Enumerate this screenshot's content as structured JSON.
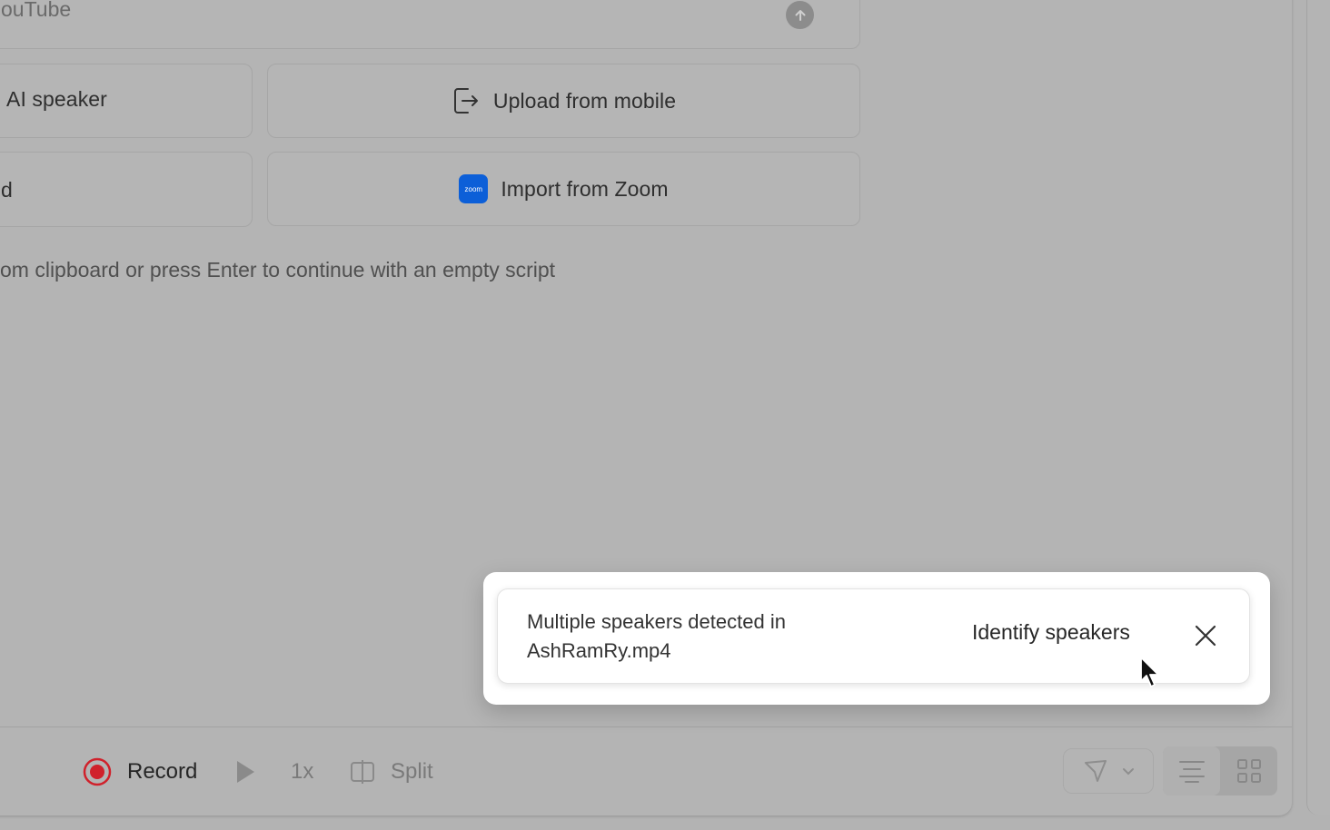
{
  "source": {
    "url_placeholder": "Paste a link from YouTube",
    "visible_placeholder": "ouTube"
  },
  "options": {
    "ai_speaker_label": "AI speaker",
    "upload_mobile_label": "Upload from mobile",
    "record_label_partial": "d",
    "import_zoom_label": "Import from Zoom",
    "zoom_logo_text": "zoom"
  },
  "hint": {
    "text": "om clipboard or press Enter to continue with an empty script"
  },
  "toast": {
    "message": "Multiple speakers detected in AshRamRy.mp4",
    "action_label": "Identify speakers"
  },
  "toolbar": {
    "record_label": "Record",
    "speed_label": "1x",
    "split_label": "Split"
  },
  "colors": {
    "record_red": "#d0212b",
    "zoom_blue": "#0c5fd8",
    "overlay_gray": "#b4b4b4"
  }
}
